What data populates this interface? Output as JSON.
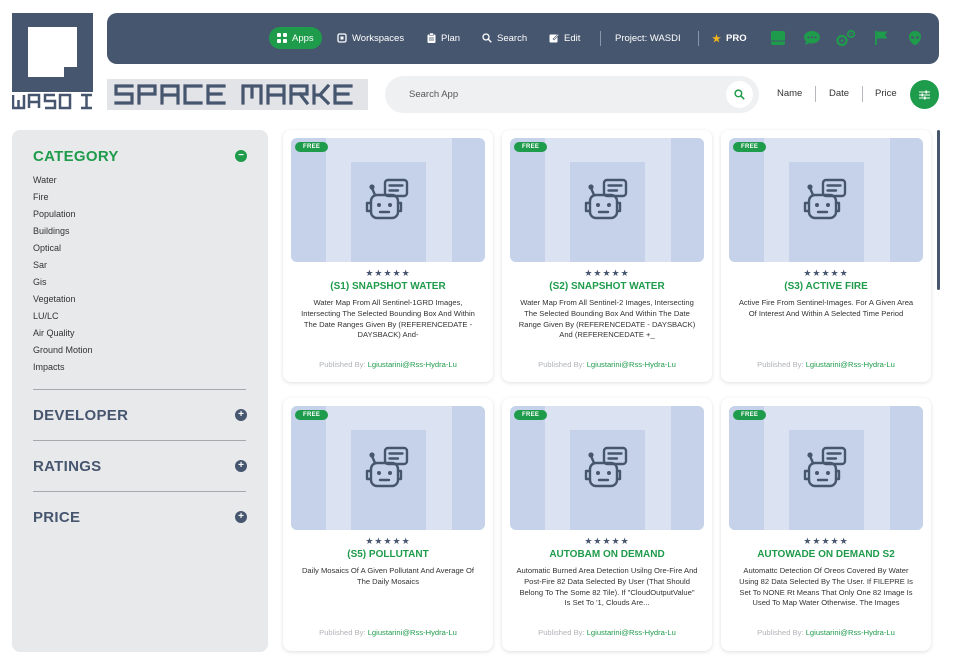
{
  "brand": {
    "logo_text": "WASDI",
    "title": "SPACE MARKET"
  },
  "nav": {
    "apps": "Apps",
    "workspaces": "Workspaces",
    "plan": "Plan",
    "search": "Search",
    "edit": "Edit",
    "project": "Project: WASDI",
    "pro": "PRO",
    "icons": [
      "table-icon",
      "chat-icon",
      "settings-icon",
      "flag-icon",
      "alien-icon"
    ]
  },
  "search": {
    "placeholder": "Search App"
  },
  "sort": {
    "name": "Name",
    "date": "Date",
    "price": "Price"
  },
  "sidebar": {
    "category_title": "CATEGORY",
    "categories": [
      "Water",
      "Fire",
      "Population",
      "Buildings",
      "Optical",
      "Sar",
      "Gis",
      "Vegetation",
      "LU/LC",
      "Air Quality",
      "Ground Motion",
      "Impacts"
    ],
    "developer_title": "DEVELOPER",
    "ratings_title": "RATINGS",
    "price_title": "PRICE"
  },
  "cards": [
    {
      "badge": "FREE",
      "stars": "★★★★★",
      "title": "(S1) SNAPSHOT WATER",
      "description": "Water Map From All Sentinel-1GRD Images, Intersecting The Selected Bounding Box And Within The Date Ranges Given By (REFERENCEDATE - DAYSBACK) And-",
      "published_label": "Published By:",
      "author": "Lgiustarini@Rss-Hydra-Lu"
    },
    {
      "badge": "FREE",
      "stars": "★★★★★",
      "title": "(S2) SNAPSHOT WATER",
      "description": "Water Map From All Sentinel-2 Images, Intersecting The Selected Bounding Box And Within The Date Range Given By (REFERENCEDATE - DAYSBACK) And (REFERENCEDATE +_",
      "published_label": "Published By:",
      "author": "Lgiustarini@Rss-Hydra-Lu"
    },
    {
      "badge": "FREE",
      "stars": "★★★★★",
      "title": "(S3) ACTIVE FIRE",
      "description": "Active Fire From Sentinel-Images. For A Given Area Of Interest And Within A Selected Time Period",
      "published_label": "Published By:",
      "author": "Lgiustarini@Rss-Hydra-Lu"
    },
    {
      "badge": "FREE",
      "stars": "★★★★★",
      "title": "(S5) POLLUTANT",
      "description": "Daily Mosaics Of A Given Pollutant And Average Of The Daily Mosaics",
      "published_label": "Published By:",
      "author": "Lgiustarini@Rss-Hydra-Lu"
    },
    {
      "badge": "FREE",
      "stars": "★★★★★",
      "title": "AUTOBAM ON DEMAND",
      "description": "Automatic Burned Area Detection Usilng Ore-Fire And Post-Fire 82 Data Selected By User (That Should Belong To The Some 82 Tile). If \"CloudOutputValue\" Is Set To '1, Clouds Are...",
      "published_label": "Published By:",
      "author": "Lgiustarini@Rss-Hydra-Lu"
    },
    {
      "badge": "FREE",
      "stars": "★★★★★",
      "title": "AUTOWADE ON DEMAND S2",
      "description": "Automattc Detection Of Oreos Covered By Water Using 82 Data Selected By The User. If FILEPRE Is Set To NONE Rt Means That Only One 82 Image Is Used To Map Water Otherwise. The Images",
      "published_label": "Published By:",
      "author": "Lgiustarini@Rss-Hydra-Lu"
    }
  ]
}
